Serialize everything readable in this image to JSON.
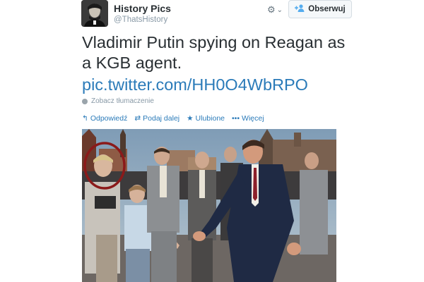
{
  "author": {
    "name": "History Pics",
    "handle": "@ThatsHistory"
  },
  "header": {
    "gear_icon": "⚙",
    "gear_caret": "⌄",
    "follow_label": "Obserwuj",
    "follow_icon": "person-plus-icon"
  },
  "tweet": {
    "text": "Vladimir Putin spying on Reagan as a KGB agent.",
    "link": "pic.twitter.com/HH0O4WbRPO",
    "translate_label": "Zobacz tłumaczenie"
  },
  "actions": {
    "reply": "Odpowiedź",
    "retweet": "Podaj dalej",
    "favorite": "Ulubione",
    "more": "Więcej"
  },
  "colors": {
    "link": "#2b7bb9",
    "muted": "#8899a6",
    "text": "#292f33",
    "highlight_circle": "#8b1a1a"
  }
}
